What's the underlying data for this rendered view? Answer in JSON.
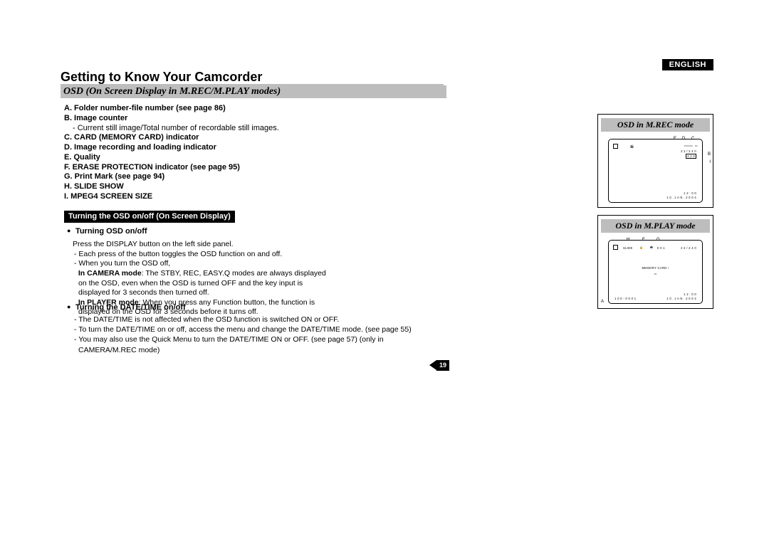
{
  "language": "ENGLISH",
  "section_title": "Getting to Know Your Camcorder",
  "osd_header": "OSD (On Screen Display in M.REC/M.PLAY modes)",
  "items": {
    "a": "A. Folder number-file number (see page 86)",
    "b": "B. Image counter",
    "b_sub": "- Current still image/Total number of recordable still images.",
    "c": "C. CARD (MEMORY CARD) indicator",
    "d": "D. Image recording and loading indicator",
    "e": "E. Quality",
    "f": "F.  ERASE PROTECTION indicator (see page 95)",
    "g": "G. Print Mark (see page 94)",
    "h": "H. SLIDE SHOW",
    "i": "I.   MPEG4 SCREEN SIZE"
  },
  "box": {
    "title": "Turning the OSD on/off (On Screen Display)",
    "t1": "Turning OSD on/off",
    "p1": "Press the DISPLAY button on the left side panel.",
    "p2": "- Each press of the button toggles the OSD function on and off.",
    "p3": "- When you turn the OSD off,",
    "p4_lead": "In CAMERA mode",
    "p4": ": The STBY, REC, EASY.Q modes are always displayed on the OSD, even when the OSD is turned OFF and the key input is displayed for 3 seconds then turned off.",
    "p5_lead": "In PLAYER mode",
    "p5": ": When you press any Function button, the function is displayed on the OSD for 3 seconds before it turns off.",
    "t2": "Turning the DATE/TIME on/off",
    "b1": "- The DATE/TIME is not affected when the OSD function is switched ON or OFF.",
    "b2": "- To turn the DATE/TIME on or off, access the menu and change the DATE/TIME mode. (see page 55)",
    "b3": "- You may also use the Quick Menu to turn the DATE/TIME ON or OFF. (see page 57) (only in CAMERA/M.REC mode)"
  },
  "panels": {
    "mrec_title": "OSD in M.REC mode",
    "mplay_title": "OSD in M.PLAY mode",
    "mrec": {
      "top_e": "E",
      "top_d": "D",
      "top_c": "C",
      "right_b": "B",
      "right_i": "I",
      "num": "2 2 / 2 4 0",
      "size": "3 2 0",
      "time": "1 2 : 0 0",
      "date": "1 0 . J A N . 2 0 0 4"
    },
    "mplay": {
      "top_h": "H",
      "top_f": "F",
      "top_g": "G",
      "left_a": "A",
      "slide": "SLIDE",
      "num001": "0 0 1",
      "num22": "2 2 / 2 4 0",
      "memcard": "MEMORY CARD !",
      "folder": "1 0 0 - 0 0 0 1",
      "time": "1 2 : 0 0",
      "date": "1 0 . J A N . 2 0 0 4"
    }
  },
  "page_number": "19"
}
